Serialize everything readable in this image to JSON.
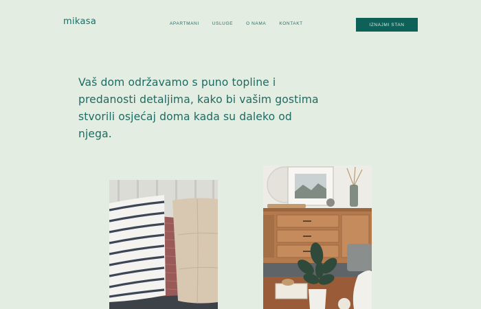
{
  "brand": {
    "logo_text": "mikasa"
  },
  "nav": {
    "items": [
      {
        "label": "APARTMANI"
      },
      {
        "label": "USLUGE"
      },
      {
        "label": "O NAMA"
      },
      {
        "label": "KONTAKT"
      }
    ]
  },
  "cta": {
    "label": "IZNAJMI STAN"
  },
  "hero": {
    "line_1": "Vaš dom održavamo s puno topline i",
    "line_2": "predanosti detaljima, kako bi vašim gostima",
    "line_3": "stvorili osjećaj doma kada su daleko od njega."
  },
  "colors": {
    "background": "#e3ede1",
    "accent": "#0e6158",
    "text": "#1e6b63"
  },
  "images": [
    {
      "icon": "pillows-photo"
    },
    {
      "icon": "living-room-photo"
    }
  ]
}
